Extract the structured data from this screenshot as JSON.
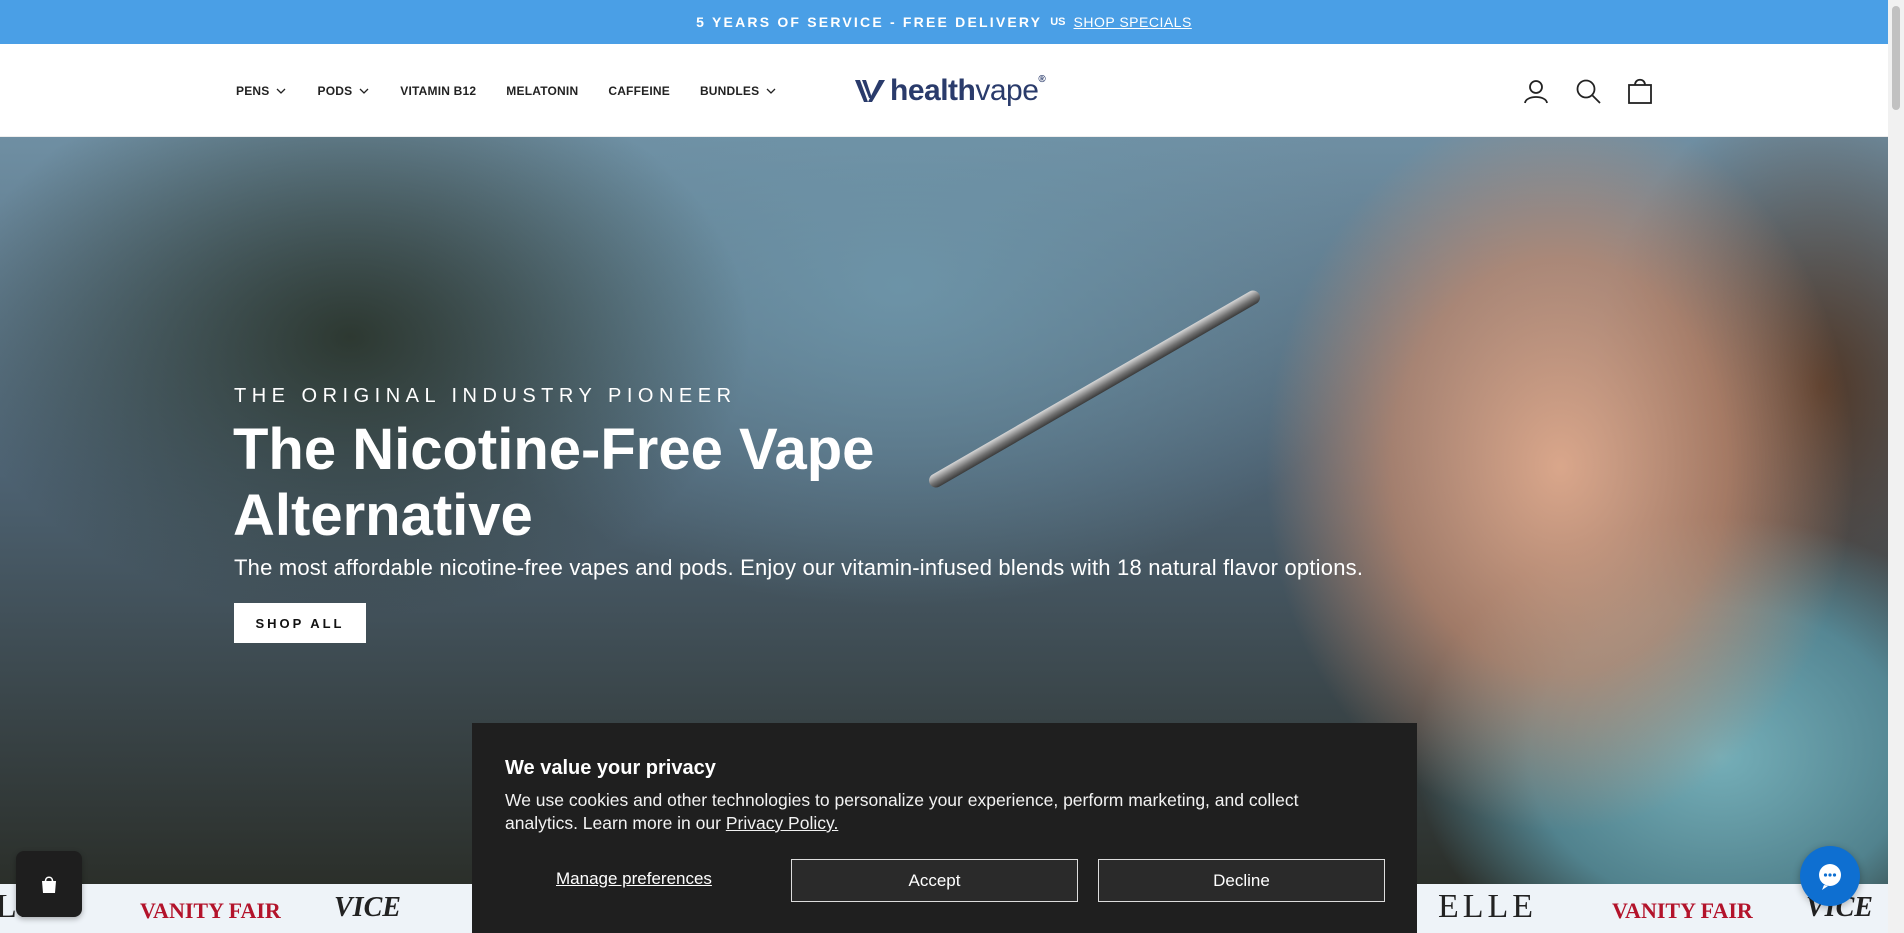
{
  "announcement": {
    "text": "5 YEARS OF SERVICE - FREE DELIVERY",
    "flag": "US",
    "link": "SHOP SPECIALS"
  },
  "nav": {
    "items": [
      {
        "label": "PENS",
        "dropdown": true
      },
      {
        "label": "PODS",
        "dropdown": true
      },
      {
        "label": "VITAMIN B12",
        "dropdown": false
      },
      {
        "label": "MELATONIN",
        "dropdown": false
      },
      {
        "label": "CAFFEINE",
        "dropdown": false
      },
      {
        "label": "BUNDLES",
        "dropdown": true
      }
    ]
  },
  "logo": {
    "bold": "health",
    "light": "vape",
    "mark": "®"
  },
  "header_icons": [
    "account-icon",
    "search-icon",
    "cart-icon"
  ],
  "hero": {
    "eyebrow": "THE ORIGINAL INDUSTRY PIONEER",
    "title": "The Nicotine-Free Vape Alternative",
    "subtitle": "The most affordable nicotine-free vapes and pods. Enjoy our vitamin-infused blends with 18 natural flavor options.",
    "cta": "SHOP ALL"
  },
  "press": [
    "LLE",
    "VANITY FAIR",
    "VICE",
    "ELLE",
    "VANITY FAIR",
    "VICE"
  ],
  "cookie": {
    "title": "We value your privacy",
    "body": "We use cookies and other technologies to personalize your experience, perform marketing, and collect analytics. Learn more in our",
    "policy_link": "Privacy Policy.",
    "manage": "Manage preferences",
    "accept": "Accept",
    "decline": "Decline"
  },
  "colors": {
    "announcement_bg": "#4a9fe6",
    "brand_navy": "#2a3b6b",
    "cookie_bg": "#1f1f1f",
    "chat_blue": "#0e6fd1"
  }
}
